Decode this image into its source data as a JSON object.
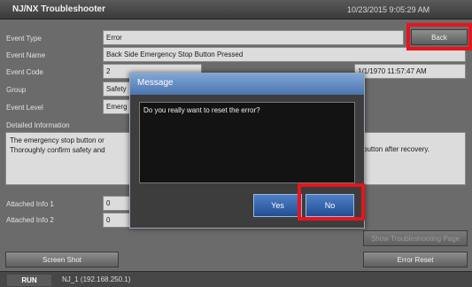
{
  "title_bar": {
    "app_name": "NJ/NX Troubleshooter",
    "datetime": "10/23/2015 9:05:29 AM"
  },
  "labels": {
    "event_type": "Event Type",
    "event_name": "Event Name",
    "event_code": "Event Code",
    "group": "Group",
    "event_level": "Event Level",
    "detailed_information": "Detailed Information",
    "attached_info_1": "Attached Info 1",
    "attached_info_2": "Attached Info 2"
  },
  "fields": {
    "event_type": "Error",
    "event_name": "Back Side Emergency Stop Button Pressed",
    "event_code": "2",
    "event_time": "1/1/1970 11:57:47 AM",
    "group": "Safety",
    "event_level": "Emerg",
    "attached_info_1": "0",
    "attached_info_2": "0"
  },
  "detailed_information": {
    "line1": "The emergency stop button or",
    "line2": "Thoroughly confirm safety and",
    "line2_tail": "button after recovery."
  },
  "buttons": {
    "back": "Back",
    "screen_shot": "Screen Shot",
    "show_troubleshooting_page": "Show Troubleshooting Page",
    "error_reset": "Error Reset"
  },
  "status_bar": {
    "mode": "RUN",
    "node": "NJ_1 (192.168.250.1)"
  },
  "dialog": {
    "title": "Message",
    "message": "Do you really want to reset the error?",
    "yes": "Yes",
    "no": "No"
  },
  "colors": {
    "highlight": "#e8141c",
    "dialog_title": "#5a80b8",
    "dialog_button": "#2f5fa8"
  }
}
